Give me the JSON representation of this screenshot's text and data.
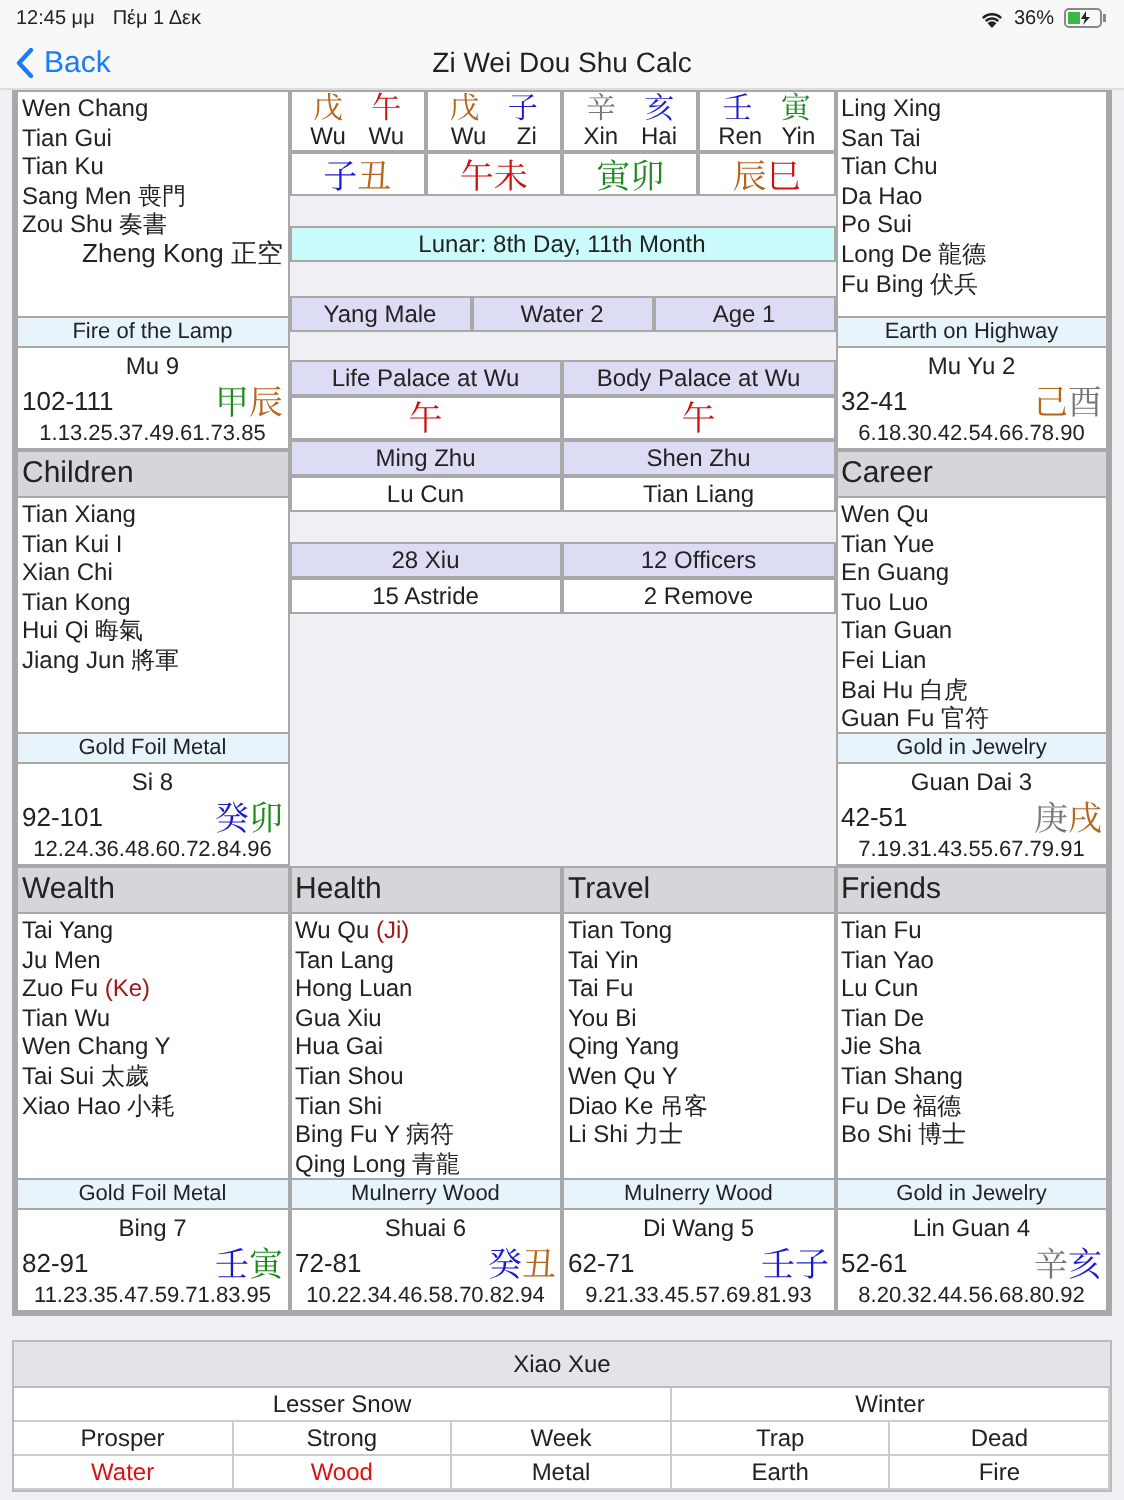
{
  "status_bar": {
    "time": "12:45 μμ",
    "date": "Πέμ 1 Δεκ",
    "battery": "36%"
  },
  "nav": {
    "back": "Back",
    "title": "Zi Wei Dou Shu Calc"
  },
  "palaces": [
    {
      "stars": [
        {
          "name": "Wen Chang"
        },
        {
          "name": "Tian Gui"
        },
        {
          "name": "Tian Ku"
        },
        {
          "name": "Sang Men 喪門"
        },
        {
          "name": "Zou Shu 奏書"
        },
        {
          "name": "Zheng Kong 正空",
          "align_right": true
        }
      ],
      "element": "Fire of the Lamp",
      "stage": "Mu 9",
      "ages": "102-111",
      "ganzhi": [
        {
          "char": "甲",
          "color": "#1e8a1e"
        },
        {
          "char": "辰",
          "color": "#b8651c"
        }
      ],
      "years": "1.13.25.37.49.61.73.85"
    },
    {
      "stars": [
        {
          "name": "Ling Xing"
        },
        {
          "name": "San Tai"
        },
        {
          "name": "Tian Chu"
        },
        {
          "name": "Da Hao"
        },
        {
          "name": "Po Sui"
        },
        {
          "name": "Long De 龍德"
        },
        {
          "name": "Fu Bing 伏兵"
        }
      ],
      "element": "Earth on Highway",
      "stage": "Mu Yu 2",
      "ages": "32-41",
      "ganzhi": [
        {
          "char": "己",
          "color": "#b8651c"
        },
        {
          "char": "酉",
          "color": "#777777"
        }
      ],
      "years": "6.18.30.42.54.66.78.90"
    },
    {
      "name": "Children",
      "stars": [
        {
          "name": "Tian Xiang"
        },
        {
          "name": "Tian Kui I"
        },
        {
          "name": "Xian Chi"
        },
        {
          "name": "Tian Kong"
        },
        {
          "name": "Hui Qi 晦氣"
        },
        {
          "name": "Jiang Jun 將軍"
        }
      ],
      "element": "Gold Foil Metal",
      "stage": "Si 8",
      "ages": "92-101",
      "ganzhi": [
        {
          "char": "癸",
          "color": "#1a1acc"
        },
        {
          "char": "卯",
          "color": "#1e8a1e"
        }
      ],
      "years": "12.24.36.48.60.72.84.96"
    },
    {
      "name": "Career",
      "stars": [
        {
          "name": "Wen Qu"
        },
        {
          "name": "Tian Yue"
        },
        {
          "name": "En Guang"
        },
        {
          "name": "Tuo Luo"
        },
        {
          "name": "Tian Guan"
        },
        {
          "name": "Fei Lian"
        },
        {
          "name": "Bai Hu 白虎"
        },
        {
          "name": "Guan Fu 官符"
        }
      ],
      "element": "Gold in Jewelry",
      "stage": "Guan Dai 3",
      "ages": "42-51",
      "ganzhi": [
        {
          "char": "庚",
          "color": "#777777"
        },
        {
          "char": "戌",
          "color": "#b8651c"
        }
      ],
      "years": "7.19.31.43.55.67.79.91"
    },
    {
      "name": "Wealth",
      "stars": [
        {
          "name": "Tai Yang"
        },
        {
          "name": "Ju Men"
        },
        {
          "name": "Zuo Fu",
          "transform": "(Ke)"
        },
        {
          "name": "Tian Wu"
        },
        {
          "name": "Wen Chang Y"
        },
        {
          "name": "Tai Sui 太歲"
        },
        {
          "name": "Xiao Hao 小耗"
        }
      ],
      "element": "Gold Foil Metal",
      "stage": "Bing 7",
      "ages": "82-91",
      "ganzhi": [
        {
          "char": "壬",
          "color": "#1a1acc"
        },
        {
          "char": "寅",
          "color": "#1e8a1e"
        }
      ],
      "years": "11.23.35.47.59.71.83.95"
    },
    {
      "name": "Health",
      "stars": [
        {
          "name": "Wu Qu",
          "transform": "(Ji)"
        },
        {
          "name": "Tan Lang"
        },
        {
          "name": "Hong Luan"
        },
        {
          "name": "Gua Xiu"
        },
        {
          "name": "Hua Gai"
        },
        {
          "name": "Tian Shou"
        },
        {
          "name": "Tian Shi"
        },
        {
          "name": "Bing Fu Y 病符"
        },
        {
          "name": "Qing Long 青龍"
        }
      ],
      "element": "Mulnerry Wood",
      "stage": "Shuai 6",
      "ages": "72-81",
      "ganzhi": [
        {
          "char": "癸",
          "color": "#1a1acc"
        },
        {
          "char": "丑",
          "color": "#b8651c"
        }
      ],
      "years": "10.22.34.46.58.70.82.94"
    },
    {
      "name": "Travel",
      "stars": [
        {
          "name": "Tian Tong"
        },
        {
          "name": "Tai Yin"
        },
        {
          "name": "Tai Fu"
        },
        {
          "name": "You Bi"
        },
        {
          "name": "Qing Yang"
        },
        {
          "name": "Wen Qu Y"
        },
        {
          "name": "Diao Ke 吊客"
        },
        {
          "name": "Li Shi 力士"
        }
      ],
      "element": "Mulnerry Wood",
      "stage": "Di Wang 5",
      "ages": "62-71",
      "ganzhi": [
        {
          "char": "壬",
          "color": "#1a1acc"
        },
        {
          "char": "子",
          "color": "#1a1acc"
        }
      ],
      "years": "9.21.33.45.57.69.81.93"
    },
    {
      "name": "Friends",
      "stars": [
        {
          "name": "Tian Fu"
        },
        {
          "name": "Tian Yao"
        },
        {
          "name": "Lu Cun"
        },
        {
          "name": "Tian De"
        },
        {
          "name": "Jie Sha"
        },
        {
          "name": "Tian Shang"
        },
        {
          "name": "Fu De 福德"
        },
        {
          "name": "Bo Shi 博士"
        }
      ],
      "element": "Gold in Jewelry",
      "stage": "Lin Guan 4",
      "ages": "52-61",
      "ganzhi": [
        {
          "char": "辛",
          "color": "#777777"
        },
        {
          "char": "亥",
          "color": "#1a1acc"
        }
      ],
      "years": "8.20.32.44.56.68.80.92"
    }
  ],
  "center": {
    "stems": [
      {
        "chars": [
          {
            "char": "戊",
            "color": "#b8651c"
          },
          {
            "char": "午",
            "color": "#cc1111"
          }
        ],
        "pinyin": [
          "Wu",
          "Wu"
        ]
      },
      {
        "chars": [
          {
            "char": "戊",
            "color": "#b8651c"
          },
          {
            "char": "子",
            "color": "#1a1acc"
          }
        ],
        "pinyin": [
          "Wu",
          "Zi"
        ]
      },
      {
        "chars": [
          {
            "char": "辛",
            "color": "#777777"
          },
          {
            "char": "亥",
            "color": "#1a1acc"
          }
        ],
        "pinyin": [
          "Xin",
          "Hai"
        ]
      },
      {
        "chars": [
          {
            "char": "壬",
            "color": "#1a1acc"
          },
          {
            "char": "寅",
            "color": "#1e8a1e"
          }
        ],
        "pinyin": [
          "Ren",
          "Yin"
        ]
      }
    ],
    "branches": [
      [
        {
          "char": "子",
          "color": "#1a1acc"
        },
        {
          "char": "丑",
          "color": "#b8651c"
        }
      ],
      [
        {
          "char": "午",
          "color": "#cc1111"
        },
        {
          "char": "未",
          "color": "#cc1111"
        }
      ],
      [
        {
          "char": "寅",
          "color": "#1e8a1e"
        },
        {
          "char": "卯",
          "color": "#1e8a1e"
        }
      ],
      [
        {
          "char": "辰",
          "color": "#b8651c"
        },
        {
          "char": "巳",
          "color": "#cc1111"
        }
      ]
    ],
    "lunar": "Lunar: 8th Day, 11th Month",
    "profile": [
      "Yang Male",
      "Water 2",
      "Age 1"
    ],
    "palace_seats": [
      {
        "label": "Life Palace at Wu",
        "char": "午",
        "color": "#cc1111"
      },
      {
        "label": "Body Palace at Wu",
        "char": "午",
        "color": "#cc1111"
      }
    ],
    "lords": [
      {
        "label": "Ming Zhu",
        "value": "Lu Cun"
      },
      {
        "label": "Shen Zhu",
        "value": "Tian Liang"
      }
    ],
    "cycles": [
      {
        "label": "28 Xiu",
        "value": "15 Astride"
      },
      {
        "label": "12 Officers",
        "value": "2 Remove"
      }
    ]
  },
  "solar_term": {
    "title": "Xiao Xue",
    "name": "Lesser Snow",
    "season": "Winter",
    "states": [
      {
        "label": "Prosper",
        "element": "Water",
        "highlighted": true
      },
      {
        "label": "Strong",
        "element": "Wood",
        "highlighted": true
      },
      {
        "label": "Week",
        "element": "Metal",
        "highlighted": false
      },
      {
        "label": "Trap",
        "element": "Earth",
        "highlighted": false
      },
      {
        "label": "Dead",
        "element": "Fire",
        "highlighted": false
      }
    ]
  }
}
